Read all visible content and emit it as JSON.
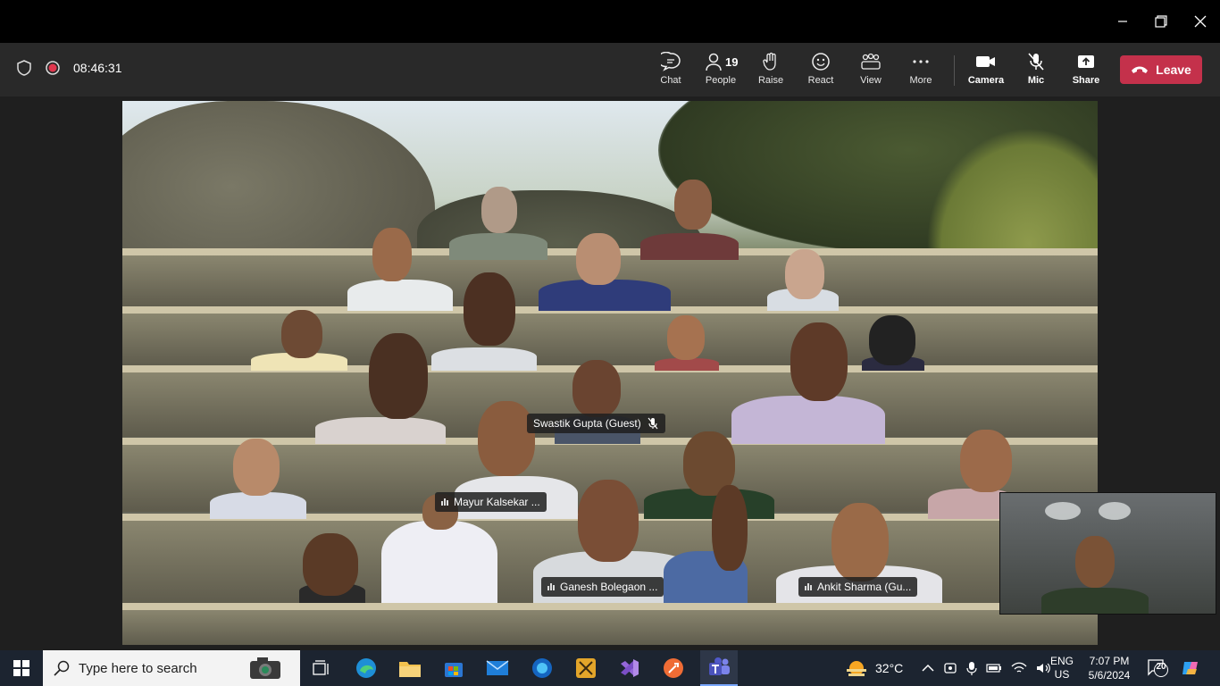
{
  "window": {
    "minimize_icon": "minimize-icon",
    "maximize_icon": "restore-icon",
    "close_icon": "close-icon"
  },
  "meeting": {
    "timer": "08:46:31"
  },
  "toolbar": {
    "chat": "Chat",
    "people": "People",
    "people_count": "19",
    "raise": "Raise",
    "react": "React",
    "view": "View",
    "more": "More",
    "camera": "Camera",
    "mic": "Mic",
    "share": "Share",
    "leave": "Leave"
  },
  "participants": {
    "speaker_tag": "Swastik Gupta (Guest)",
    "tag2": "Mayur Kalsekar ...",
    "tag3": "Ganesh Bolegaon ...",
    "tag4": "Ankit Sharma (Gu..."
  },
  "taskbar": {
    "search_placeholder": "Type here to search",
    "weather": "32°C",
    "lang1": "ENG",
    "lang2": "US",
    "time": "7:07 PM",
    "date": "5/6/2024",
    "notif_count": "20"
  },
  "colors": {
    "leave": "#c4314b",
    "toolbar": "#292929",
    "taskbar": "#1c2430"
  }
}
